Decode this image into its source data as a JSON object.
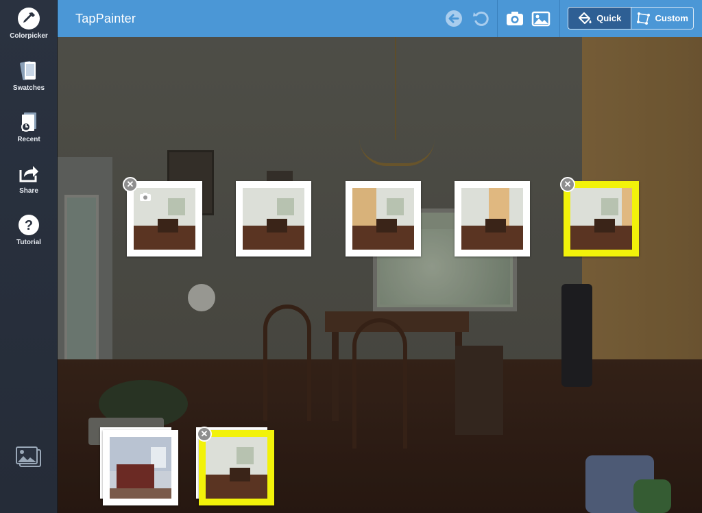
{
  "app": {
    "title": "TapPainter"
  },
  "sidebar": {
    "items": [
      {
        "label": "Colorpicker",
        "icon": "eyedropper-icon"
      },
      {
        "label": "Swatches",
        "icon": "swatches-icon"
      },
      {
        "label": "Recent",
        "icon": "recent-icon"
      },
      {
        "label": "Share",
        "icon": "share-icon"
      },
      {
        "label": "Tutorial",
        "icon": "help-icon"
      }
    ],
    "gallery_icon": "gallery-icon"
  },
  "toolbar": {
    "undo_icon": "back-arrow-icon",
    "redo_icon": "reset-icon",
    "camera_icon": "camera-icon",
    "photo_icon": "image-icon",
    "modes": [
      {
        "label": "Quick",
        "icon": "paint-bucket-icon",
        "active": true
      },
      {
        "label": "Custom",
        "icon": "polygon-icon",
        "active": false
      }
    ]
  },
  "colors": {
    "topbar": "#4b97d6",
    "sidebar": "#2a3240",
    "selected_frame": "#f2f20a",
    "active_mode": "#2e5f94"
  }
}
